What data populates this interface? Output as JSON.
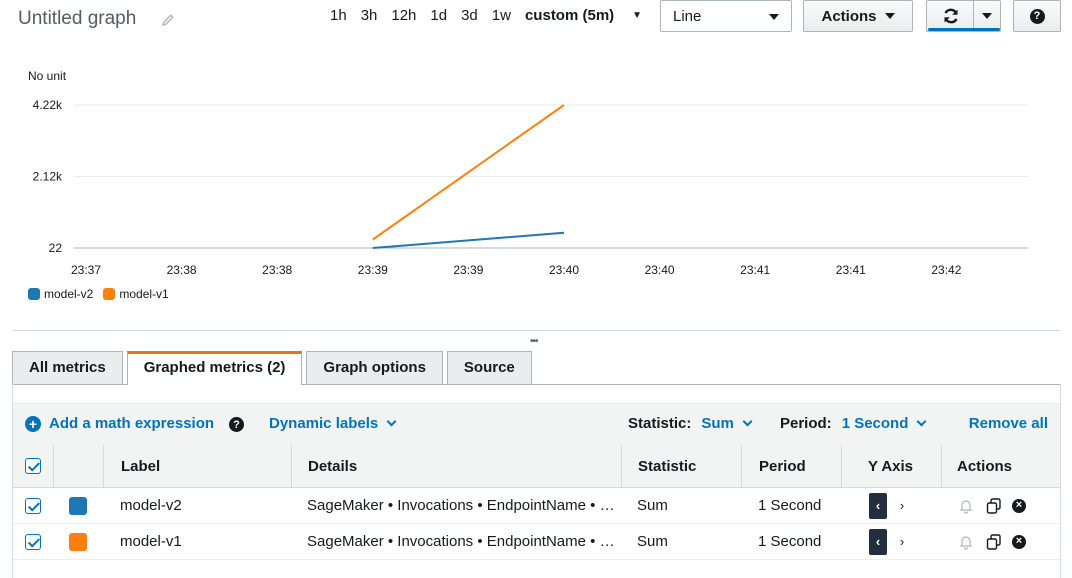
{
  "header": {
    "title": "Untitled graph",
    "ranges": [
      {
        "label": "1h",
        "active": false
      },
      {
        "label": "3h",
        "active": false
      },
      {
        "label": "12h",
        "active": false
      },
      {
        "label": "1d",
        "active": false
      },
      {
        "label": "3d",
        "active": false
      },
      {
        "label": "1w",
        "active": false
      },
      {
        "label": "custom (5m)",
        "active": true
      }
    ],
    "view_type": "Line",
    "actions_label": "Actions",
    "help_glyph": "?"
  },
  "chart_data": {
    "type": "line",
    "ylabel": "No unit",
    "y_ticks": [
      "22",
      "2.12k",
      "4.22k"
    ],
    "ylim": [
      22,
      4220
    ],
    "x_ticks": [
      "23:37",
      "23:38",
      "23:38",
      "23:39",
      "23:39",
      "23:40",
      "23:40",
      "23:41",
      "23:41",
      "23:42"
    ],
    "grid": true,
    "legend_position": "bottom-left",
    "series": [
      {
        "name": "model-v2",
        "color": "#1f77b4",
        "points": [
          {
            "x_index": 3,
            "y": 22
          },
          {
            "x_index": 5,
            "y": 470
          }
        ]
      },
      {
        "name": "model-v1",
        "color": "#ff7f0e",
        "points": [
          {
            "x_index": 3,
            "y": 270
          },
          {
            "x_index": 5,
            "y": 4220
          }
        ]
      }
    ]
  },
  "tabs": [
    {
      "label": "All metrics",
      "active": false
    },
    {
      "label": "Graphed metrics (2)",
      "active": true
    },
    {
      "label": "Graph options",
      "active": false
    },
    {
      "label": "Source",
      "active": false
    }
  ],
  "toolbar": {
    "add_math": "Add a math expression",
    "dynamic_labels": "Dynamic labels",
    "statistic_label": "Statistic:",
    "statistic_value": "Sum",
    "period_label": "Period:",
    "period_value": "1 Second",
    "remove_all": "Remove all"
  },
  "table": {
    "columns": [
      "Label",
      "Details",
      "Statistic",
      "Period",
      "Y Axis",
      "Actions"
    ],
    "rows": [
      {
        "label": "model-v2",
        "color": "#1f77b4",
        "details": "SageMaker • Invocations • EndpointName • abalone",
        "statistic": "Sum",
        "period": "1 Second"
      },
      {
        "label": "model-v1",
        "color": "#ff7f0e",
        "details": "SageMaker • Invocations • EndpointName • abalone",
        "statistic": "Sum",
        "period": "1 Second"
      }
    ]
  }
}
